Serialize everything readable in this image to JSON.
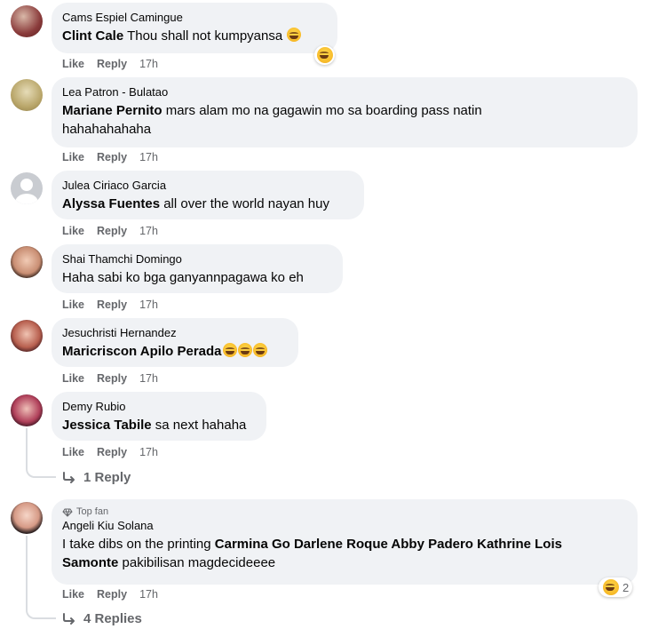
{
  "comments": [
    {
      "author": "Cams Espiel Camingue",
      "mention": "Clint Cale",
      "text": " Thou shall not kumpyansa",
      "like": "Like",
      "reply": "Reply",
      "time": "17h",
      "reaction_count": ""
    },
    {
      "author": "Lea Patron - Bulatao",
      "mention": "Mariane Pernito",
      "text": " mars alam mo na gagawin mo sa boarding pass natin",
      "text2": "hahahahahaha",
      "like": "Like",
      "reply": "Reply",
      "time": "17h"
    },
    {
      "author": "Julea Ciriaco Garcia",
      "mention": "Alyssa Fuentes",
      "text": " all over the world nayan huy",
      "like": "Like",
      "reply": "Reply",
      "time": "17h"
    },
    {
      "author": "Shai Thamchi Domingo",
      "mention": "",
      "text": "Haha sabi ko bga ganyannpagawa ko eh",
      "like": "Like",
      "reply": "Reply",
      "time": "17h"
    },
    {
      "author": "Jesuchristi Hernandez",
      "mention": "Maricriscon Apilo Perada",
      "text": "",
      "like": "Like",
      "reply": "Reply",
      "time": "17h"
    },
    {
      "author": "Demy Rubio",
      "mention": "Jessica Tabile",
      "text": " sa next hahaha",
      "like": "Like",
      "reply": "Reply",
      "time": "17h",
      "replies_label": "1 Reply"
    },
    {
      "badge": "Top fan",
      "author": "Angeli Kiu Solana",
      "text_pre": "I take dibs on the printing ",
      "mentions": "Carmina Go Darlene Roque Abby Padero Kathrine Lois",
      "mention_line2": "Samonte",
      "text_post": " pakibilisan magdecideeee",
      "like": "Like",
      "reply": "Reply",
      "time": "17h",
      "reaction_count": "2",
      "replies_label": "4 Replies"
    }
  ],
  "colors": {
    "bubble": "#f0f2f5",
    "meta": "#65676b",
    "text": "#050505"
  },
  "icons": {
    "reaction": "laughing-emoji",
    "reply_arrow": "reply-arrow-icon",
    "badge": "diamond-icon"
  }
}
